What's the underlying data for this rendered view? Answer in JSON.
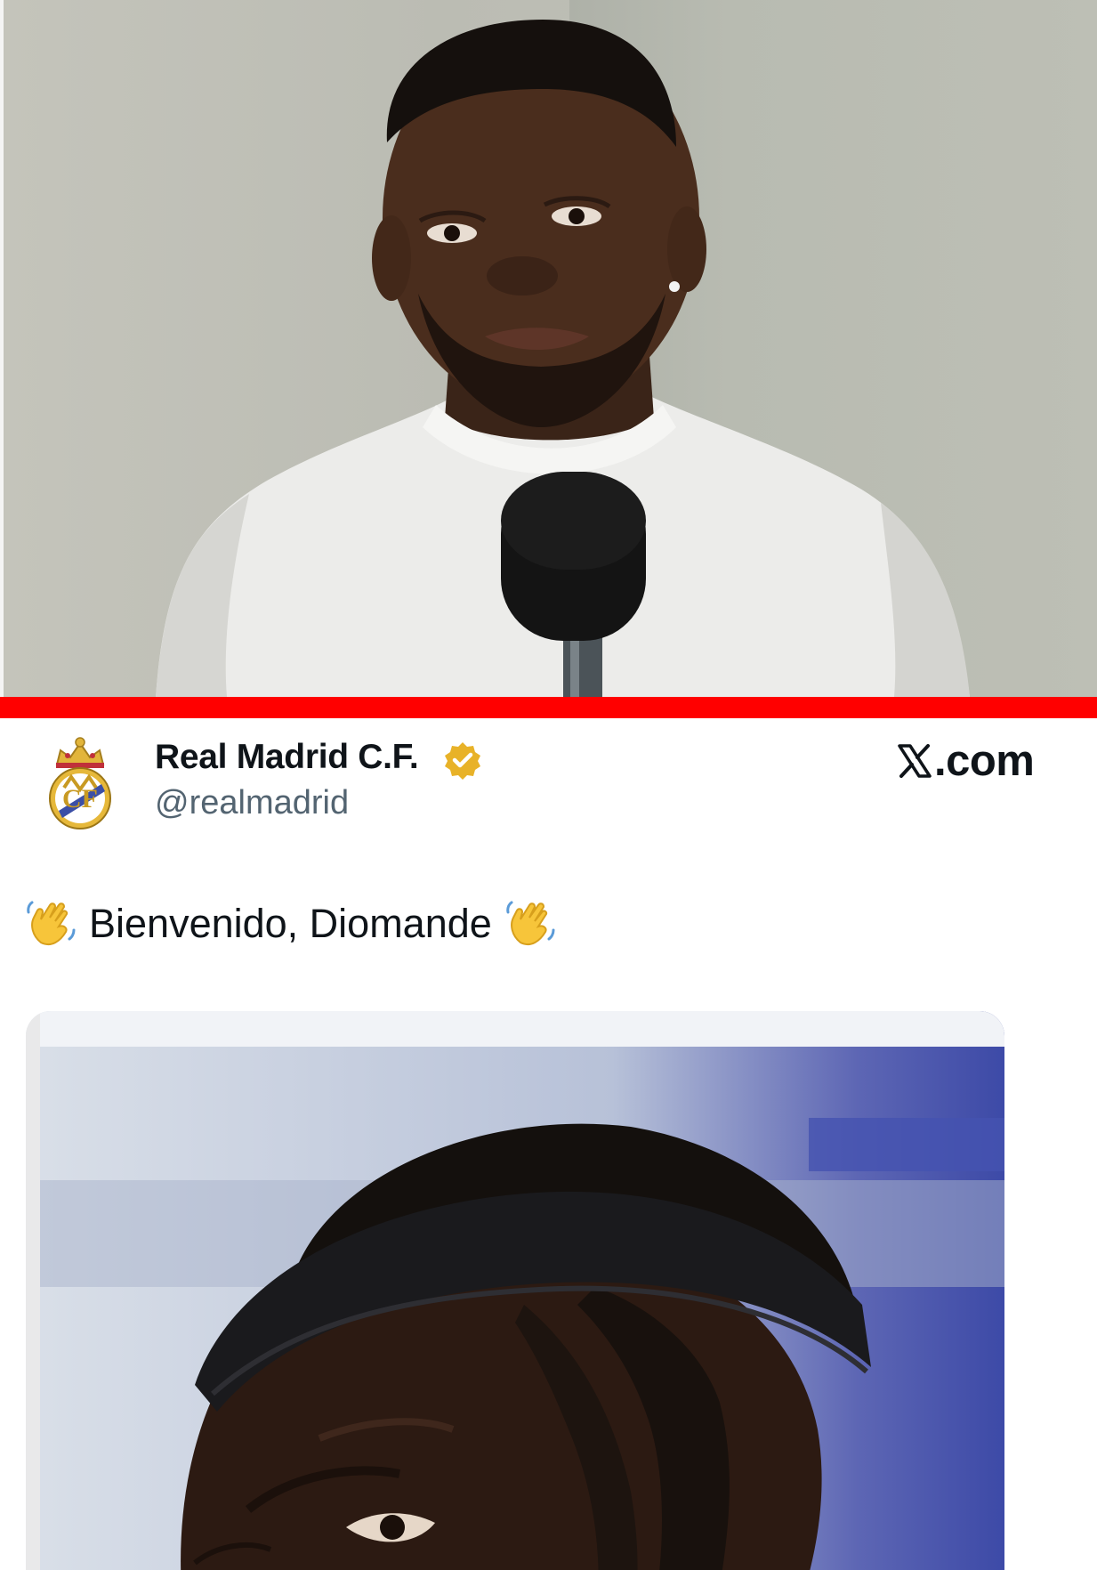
{
  "tweet": {
    "account_name": "Real Madrid C.F.",
    "handle": "@realmadrid",
    "verified": true,
    "brand": ".com",
    "text": "Bienvenido, Diomande",
    "emoji_before": "waving-hand-emoji",
    "emoji_after": "waving-hand-emoji"
  },
  "colors": {
    "accent_bar": "#ff0000",
    "verified_badge": "#e8b228",
    "text_primary": "#0f1419",
    "text_secondary": "#536471"
  },
  "icons": {
    "avatar": "real-madrid-crest-icon",
    "badge": "verified-badge-icon",
    "brand": "x-logo-icon"
  }
}
